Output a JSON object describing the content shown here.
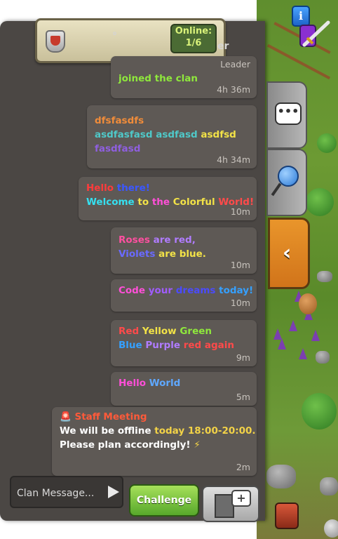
{
  "header": {
    "online_label": "Online:",
    "online_count": "1/6",
    "truncated_left": "°",
    "truncated_right": "er"
  },
  "messages": [
    {
      "role": "Leader",
      "lines": [
        [
          {
            "t": "joined the clan",
            "c": "#8fe83c"
          }
        ]
      ],
      "time": "4h 36m"
    },
    {
      "lines": [
        [
          {
            "t": "dfsfasdfs",
            "c": "#f08c3a"
          }
        ],
        [
          {
            "t": "asdfasfasd asdfasd ",
            "c": "#4fc9c9"
          },
          {
            "t": "asdfsd",
            "c": "#f2e247"
          }
        ],
        [
          {
            "t": "fasdfasd",
            "c": "#8f5fe0"
          }
        ]
      ],
      "time": "4h 34m"
    },
    {
      "lines": [
        [
          {
            "t": "Hello ",
            "c": "#ff3b3b"
          },
          {
            "t": "there!",
            "c": "#3b57ff"
          }
        ],
        [
          {
            "t": "Welcome ",
            "c": "#35e0f0"
          },
          {
            "t": "to ",
            "c": "#f2e247"
          },
          {
            "t": "the ",
            "c": "#ff4fd8"
          },
          {
            "t": "Colorful ",
            "c": "#f2e247"
          },
          {
            "t": "World!",
            "c": "#ff4a4a"
          }
        ]
      ],
      "time": "10m"
    },
    {
      "lines": [
        [
          {
            "t": "Roses ",
            "c": "#ff4fa0"
          },
          {
            "t": "are red,",
            "c": "#b07cff"
          }
        ],
        [
          {
            "t": "Violets ",
            "c": "#6a6aff"
          },
          {
            "t": "are ",
            "c": "#f2e247"
          },
          {
            "t": "blue.",
            "c": "#f2e247"
          }
        ]
      ],
      "time": "10m"
    },
    {
      "lines": [
        [
          {
            "t": "Code ",
            "c": "#ff4fd8"
          },
          {
            "t": "your ",
            "c": "#a05cff"
          },
          {
            "t": "dreams ",
            "c": "#4b4bff"
          },
          {
            "t": "today!",
            "c": "#35a0ff"
          }
        ]
      ],
      "time": "10m"
    },
    {
      "lines": [
        [
          {
            "t": "Red ",
            "c": "#ff4a4a"
          },
          {
            "t": "Yellow ",
            "c": "#f2e247"
          },
          {
            "t": "Green",
            "c": "#8fe83c"
          }
        ],
        [
          {
            "t": "Blue ",
            "c": "#35a0ff"
          },
          {
            "t": "Purple ",
            "c": "#b07cff"
          },
          {
            "t": "red again",
            "c": "#ff4a4a"
          }
        ]
      ],
      "time": "9m"
    },
    {
      "lines": [
        [
          {
            "t": "Hello ",
            "c": "#ff4fd8"
          },
          {
            "t": "World",
            "c": "#5fa8ff"
          }
        ]
      ],
      "time": "5m"
    },
    {
      "lines": [
        [
          {
            "t": "🚨 Staff Meeting",
            "c": "#ff5a3a"
          }
        ],
        [
          {
            "t": "We will be offline ",
            "c": "#ffffff"
          },
          {
            "t": "today 18:00-20:00.",
            "c": "#f2d247"
          }
        ],
        [
          {
            "t": "Please plan accordingly! ",
            "c": "#ffffff"
          },
          {
            "t": "⚡",
            "c": "#f2d247"
          }
        ]
      ],
      "time": "2m"
    }
  ],
  "input": {
    "placeholder": "Clan Message..."
  },
  "buttons": {
    "challenge": "Challenge",
    "plus": "+"
  },
  "side_tabs": {
    "chat_icon": "•••",
    "arrow": "‹"
  },
  "world": {
    "info_label": "i"
  }
}
